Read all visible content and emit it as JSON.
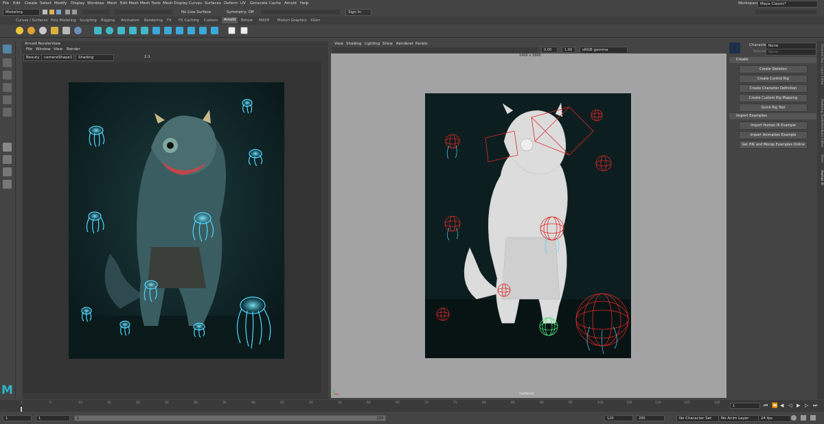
{
  "menubar": {
    "items": [
      "File",
      "Edit",
      "Create",
      "Select",
      "Modify",
      "Display",
      "Windows",
      "Mesh",
      "Edit Mesh",
      "Mesh Tools",
      "Mesh Display",
      "Curves",
      "Surfaces",
      "Deform",
      "UV",
      "Generate",
      "Cache",
      "Arnold",
      "Help"
    ],
    "workspace_label": "Workspace :",
    "workspace_value": "Maya Classic*"
  },
  "statusline": {
    "menu_set": "Modeling",
    "live_surface": "No Live Surface",
    "symmetry": "Symmetry: Off",
    "sign_in": "Sign In"
  },
  "shelf": {
    "tabs": [
      "Curves / Surfaces",
      "Poly Modeling",
      "Sculpting",
      "Rigging",
      "Animation",
      "Rendering",
      "FX",
      "FX Caching",
      "Custom",
      "Arnold",
      "Bifrost",
      "MASH",
      "Motion Graphics",
      "XGen"
    ],
    "active_tab": "Arnold"
  },
  "render_view": {
    "title": "Arnold RenderView",
    "menus": [
      "File",
      "Window",
      "View",
      "Render"
    ],
    "aov": "Beauty",
    "camera": "cameraShape1",
    "shading": "Shading",
    "zoom": "1:1"
  },
  "viewport": {
    "menus": [
      "View",
      "Shading",
      "Lighting",
      "Show",
      "Renderer",
      "Panels"
    ],
    "resolution": "1400 x 1800",
    "camera_label": "camera1",
    "exposure": "0.00",
    "gamma": "1.00",
    "color_space": "sRGB gamma"
  },
  "hik": {
    "character_label": "Character:",
    "character_value": "None",
    "source_label": "Source:",
    "source_value": "None",
    "create_header": "Create",
    "create_buttons": [
      "Create Skeleton",
      "Create Control Rig",
      "Create Character Definition",
      "Create Custom Rig Mapping",
      "Quick Rig Tool"
    ],
    "import_header": "Import Examples",
    "import_buttons": [
      "Import Human IK Example",
      "Import Animation Example",
      "Get HIK and Mocap Examples Online"
    ]
  },
  "side_tabs": [
    "Channel Box / Layer Editor",
    "Modeling Toolkit",
    "Attribute Editor",
    "XGen",
    "Human IK"
  ],
  "timeline": {
    "ticks": [
      "1",
      "5",
      "10",
      "15",
      "20",
      "25",
      "30",
      "35",
      "40",
      "45",
      "50",
      "55",
      "60",
      "65",
      "70",
      "75",
      "80",
      "85",
      "90",
      "95",
      "100",
      "105",
      "110",
      "115",
      "120"
    ],
    "current_frame": "1"
  },
  "range": {
    "start": "1",
    "playback_start": "1",
    "slider_start": "1",
    "slider_end": "120",
    "playback_end": "120",
    "end": "200",
    "character_set": "No Character Set",
    "anim_layer": "No Anim Layer",
    "fps": "24 fps"
  },
  "colors": {
    "accent": "#5285a6",
    "jelly_glow": "#4fd8ff",
    "wire_red": "#e02828",
    "wire_green": "#4be07a",
    "render_bg": "#0e2628",
    "viewport_bg": "#0c1e1f"
  }
}
